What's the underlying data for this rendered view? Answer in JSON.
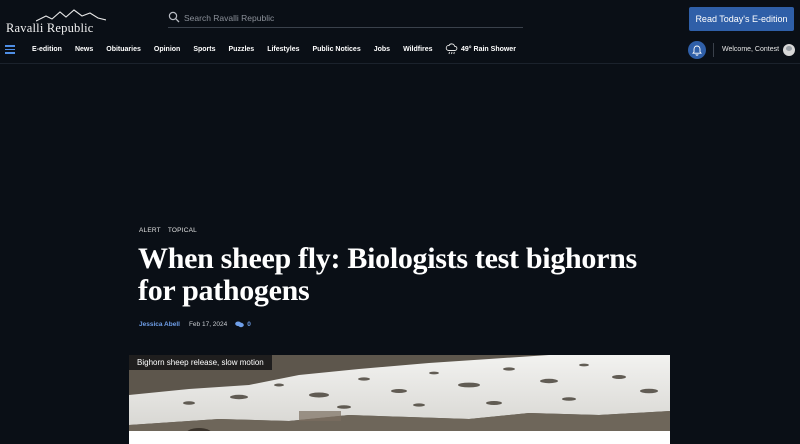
{
  "site": {
    "name": "Ravalli Republic"
  },
  "search": {
    "placeholder": "Search Ravalli Republic"
  },
  "header": {
    "edition_button": "Read Today's E-edition"
  },
  "nav": {
    "items": [
      "E-edition",
      "News",
      "Obituaries",
      "Opinion",
      "Sports",
      "Puzzles",
      "Lifestyles",
      "Public Notices",
      "Jobs",
      "Wildfires"
    ],
    "weather": "49° Rain Shower"
  },
  "user": {
    "welcome": "Welcome, Contest"
  },
  "article": {
    "tags": [
      "ALERT",
      "TOPICAL"
    ],
    "headline": "When sheep fly: Biologists test bighorns for pathogens",
    "author": "Jessica Abell",
    "date": "Feb 17, 2024",
    "comment_count": "0"
  },
  "media": {
    "caption": "Bighorn sheep release, slow motion"
  },
  "colors": {
    "background": "#0a0f16",
    "accent": "#2f5fa8",
    "link": "#6f9fe9"
  }
}
